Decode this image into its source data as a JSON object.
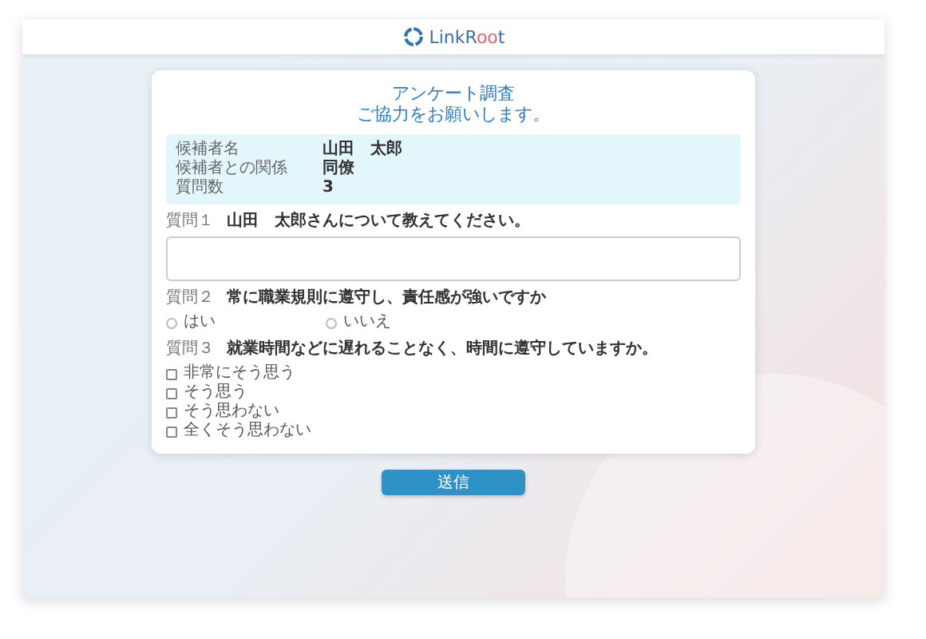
{
  "header": {
    "logo_parts": [
      "LinkR",
      "oo",
      "t"
    ]
  },
  "survey": {
    "title_lines": [
      "アンケート調査",
      "ご協力をお願いします。"
    ],
    "info": [
      {
        "label": "候補者名",
        "value": "山田　太郎"
      },
      {
        "label": "候補者との関係",
        "value": "同僚"
      },
      {
        "label": "質問数",
        "value": "3"
      }
    ],
    "questions": [
      {
        "kind": "text",
        "number": "質問１",
        "text": "山田　太郎さんについて教えてください。"
      },
      {
        "kind": "radio",
        "number": "質問２",
        "text": "常に職業規則に遵守し、責任感が強いですか",
        "options": [
          {
            "label": "はい",
            "selected": false
          },
          {
            "label": "いいえ",
            "selected": false
          }
        ]
      },
      {
        "kind": "checkbox",
        "number": "質問３",
        "text": "就業時間などに遅れることなく、時間に遵守していますか。",
        "options": [
          {
            "label": "非常にそう思う",
            "checked": false
          },
          {
            "label": "そう思う",
            "checked": false
          },
          {
            "label": "そう思わない",
            "checked": false
          },
          {
            "label": "全くそう思わない",
            "checked": false
          }
        ]
      }
    ]
  },
  "submit_button": "送信"
}
